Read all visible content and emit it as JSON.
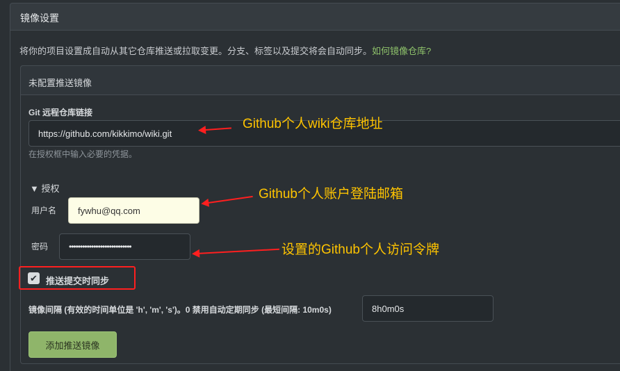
{
  "header": {
    "title": "镜像设置"
  },
  "description": {
    "text": "将你的项目设置成自动从其它仓库推送或拉取变更。分支、标签以及提交将会自动同步。",
    "link": "如何镜像仓库?"
  },
  "section": {
    "title": "未配置推送镜像"
  },
  "git_url": {
    "label": "Git 远程仓库链接",
    "value": "https://github.com/kikkimo/wiki.git",
    "hint": "在授权框中输入必要的凭据。"
  },
  "auth": {
    "toggle": "▼ 授权",
    "username_label": "用户名",
    "username_value": "fywhu@qq.com",
    "password_label": "密码",
    "password_value": "••••••••••••••••••••••••••••"
  },
  "sync": {
    "checked": true,
    "label": "推送提交时同步"
  },
  "interval": {
    "label": "镜像间隔 (有效的时间单位是 'h', 'm', 's')。0 禁用自动定期同步 (最短间隔: 10m0s)",
    "value": "8h0m0s"
  },
  "submit": {
    "label": "添加推送镜像"
  },
  "annotations": {
    "url": "Github个人wiki仓库地址",
    "email": "Github个人账户登陆邮箱",
    "token": "设置的Github个人访问令牌"
  },
  "colors": {
    "annotation": "#ffc400",
    "arrow": "#ff1f1f",
    "accent": "#8fc36b",
    "button": "#8fb56a"
  }
}
